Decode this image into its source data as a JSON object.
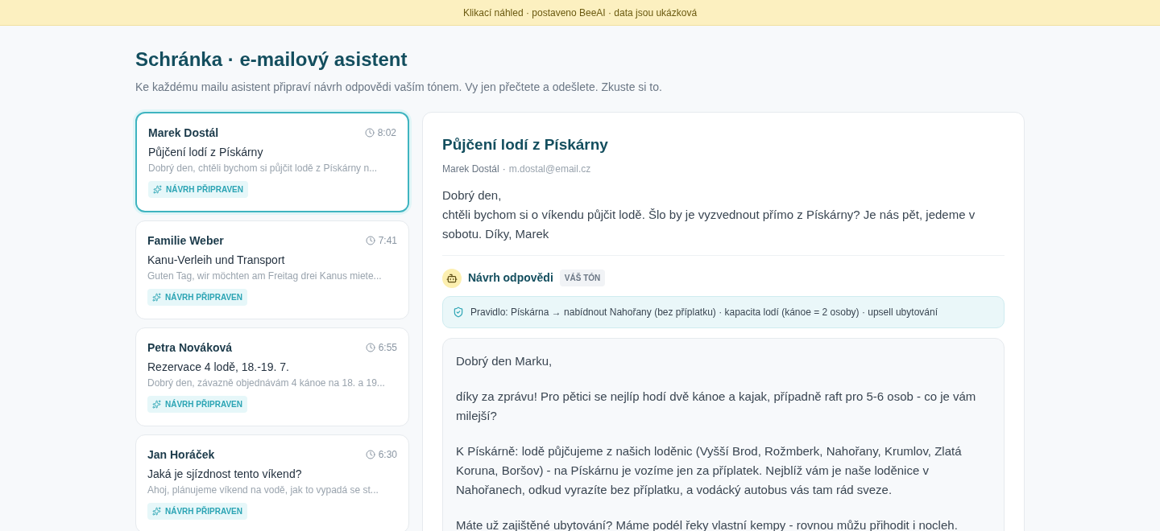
{
  "banner": "Klikací náhled · postaveno BeeAI · data jsou ukázková",
  "header": {
    "title": "Schránka · e-mailový asistent",
    "subtitle": "Ke každému mailu asistent připraví návrh odpovědi vaším tónem. Vy jen přečtete a odešlete. Zkuste si to."
  },
  "messages": [
    {
      "sender": "Marek Dostál",
      "time": "8:02",
      "subject": "Půjčení lodí z Pískárny",
      "preview": "Dobrý den, chtěli bychom si půjčit lodě z Pískárny n...",
      "badge": "NÁVRH PŘIPRAVEN",
      "selected": true
    },
    {
      "sender": "Familie Weber",
      "time": "7:41",
      "subject": "Kanu-Verleih und Transport",
      "preview": "Guten Tag, wir möchten am Freitag drei Kanus miete...",
      "badge": "NÁVRH PŘIPRAVEN",
      "selected": false
    },
    {
      "sender": "Petra Nováková",
      "time": "6:55",
      "subject": "Rezervace 4 lodě, 18.-19. 7.",
      "preview": "Dobrý den, závazně objednávám 4 kánoe na 18. a 19...",
      "badge": "NÁVRH PŘIPRAVEN",
      "selected": false
    },
    {
      "sender": "Jan Horáček",
      "time": "6:30",
      "subject": "Jaká je sjízdnost tento víkend?",
      "preview": "Ahoj, plánujeme víkend na vodě, jak to vypadá se st...",
      "badge": "NÁVRH PŘIPRAVEN",
      "selected": false
    }
  ],
  "detail": {
    "subject": "Půjčení lodí z Pískárny",
    "sender": "Marek Dostál",
    "separator": "·",
    "email": "m.dostal@email.cz",
    "body": [
      "Dobrý den,",
      "chtěli bychom si o víkendu půjčit lodě. Šlo by je vyzvednout přímo z Pískárny? Je nás pět, jedeme v sobotu. Díky, Marek"
    ],
    "draft": {
      "title": "Návrh odpovědi",
      "tag": "VÁŠ TÓN",
      "rule": "Pravidlo: Pískárna → nabídnout Nahořany (bez příplatku) · kapacita lodí (kánoe = 2 osoby) · upsell ubytování",
      "paragraphs": [
        "Dobrý den Marku,",
        "díky za zprávu! Pro pětici se nejlíp hodí dvě kánoe a kajak, případně raft pro 5-6 osob - co je vám milejší?",
        "K Pískárně: lodě půjčujeme z našich loděnic (Vyšší Brod, Rožmberk, Nahořany, Krumlov, Zlatá Koruna, Boršov) - na Pískárnu je vozíme jen za příplatek. Nejblíž vám je naše loděnice v Nahořanech, odkud vyrazíte bez příplatku, a vodácký autobus vás tam rád sveze.",
        "Máte už zajištěné ubytování? Máme podél řeky vlastní kempy - rovnou můžu přihodit i nocleh."
      ]
    }
  }
}
